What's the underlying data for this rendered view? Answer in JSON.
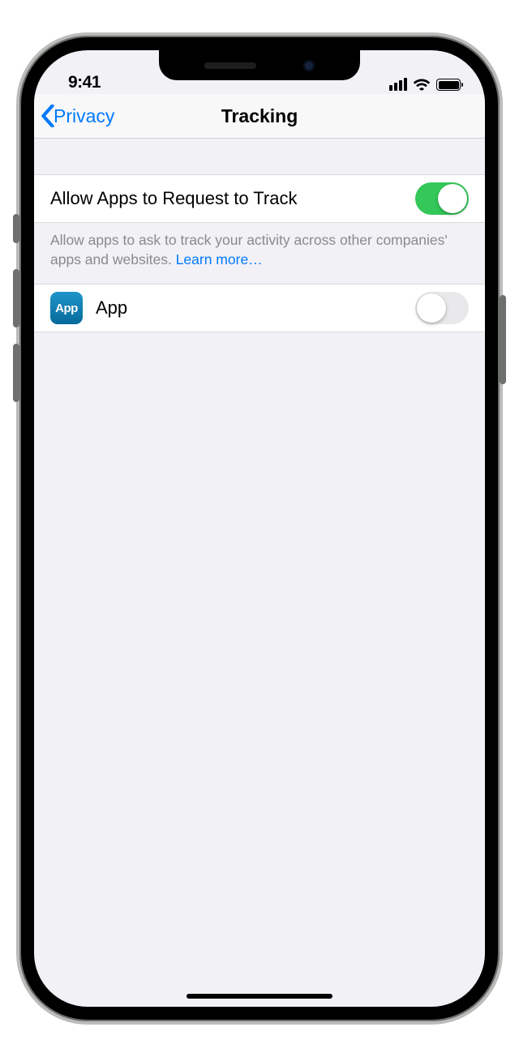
{
  "status": {
    "time": "9:41"
  },
  "nav": {
    "back_label": "Privacy",
    "title": "Tracking"
  },
  "main": {
    "allow_label": "Allow Apps to Request to Track",
    "allow_on": true,
    "footer_text": "Allow apps to ask to track your activity across other companies' apps and websites. ",
    "learn_more_label": "Learn more…"
  },
  "apps": [
    {
      "icon_text": "App",
      "name": "App",
      "on": false
    }
  ],
  "colors": {
    "tint": "#007aff",
    "toggle_on": "#34c759",
    "background": "#f2f1f6"
  }
}
